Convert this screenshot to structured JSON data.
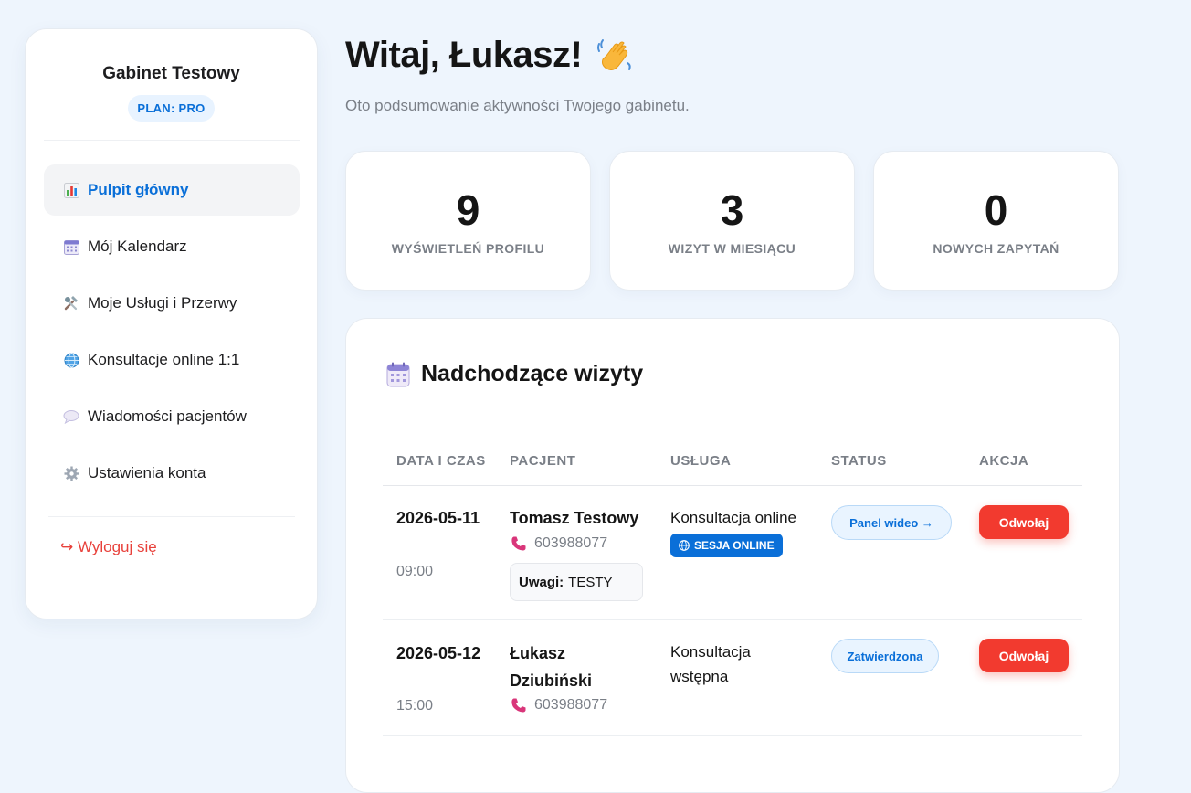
{
  "sidebar": {
    "brand": "Gabinet Testowy",
    "plan": "PLAN: PRO",
    "nav": [
      {
        "label": "Pulpit główny",
        "icon": "bar-chart-icon"
      },
      {
        "label": "Mój Kalendarz",
        "icon": "calendar-icon"
      },
      {
        "label": "Moje Usługi i Przerwy",
        "icon": "tools-icon"
      },
      {
        "label": "Konsultacje online 1:1",
        "icon": "globe-icon"
      },
      {
        "label": "Wiadomości pacjentów",
        "icon": "speech-bubble-icon"
      },
      {
        "label": "Ustawienia konta",
        "icon": "gear-icon"
      }
    ],
    "logout": "↪ Wyloguj się"
  },
  "header": {
    "greeting": "Witaj, Łukasz!",
    "subtitle": "Oto podsumowanie aktywności Twojego gabinetu."
  },
  "stats": [
    {
      "value": "9",
      "label": "WYŚWIETLEŃ PROFILU"
    },
    {
      "value": "3",
      "label": "WIZYT W MIESIĄCU"
    },
    {
      "value": "0",
      "label": "NOWYCH ZAPYTAŃ"
    }
  ],
  "appointments": {
    "title": "Nadchodzące wizyty",
    "columns": [
      "DATA I CZAS",
      "PACJENT",
      "USŁUGA",
      "STATUS",
      "AKCJA"
    ],
    "rows": [
      {
        "date": "2026-05-11",
        "time": "09:00",
        "patient": "Tomasz Testowy",
        "phone": "603988077",
        "notes_label": "Uwagi:",
        "notes": "TESTY",
        "service": "Konsultacja online",
        "badge": "SESJA ONLINE",
        "status": "Panel wideo →",
        "action": "Odwołaj"
      },
      {
        "date": "2026-05-12",
        "time": "15:00",
        "patient": "Łukasz Dziubiński",
        "phone": "603988077",
        "service": "Konsultacja wstępna",
        "status": "Zatwierdzona",
        "action": "Odwołaj"
      }
    ]
  },
  "colors": {
    "accent": "#0a6fd8",
    "danger": "#f23a2f",
    "background": "#eef5fd"
  }
}
